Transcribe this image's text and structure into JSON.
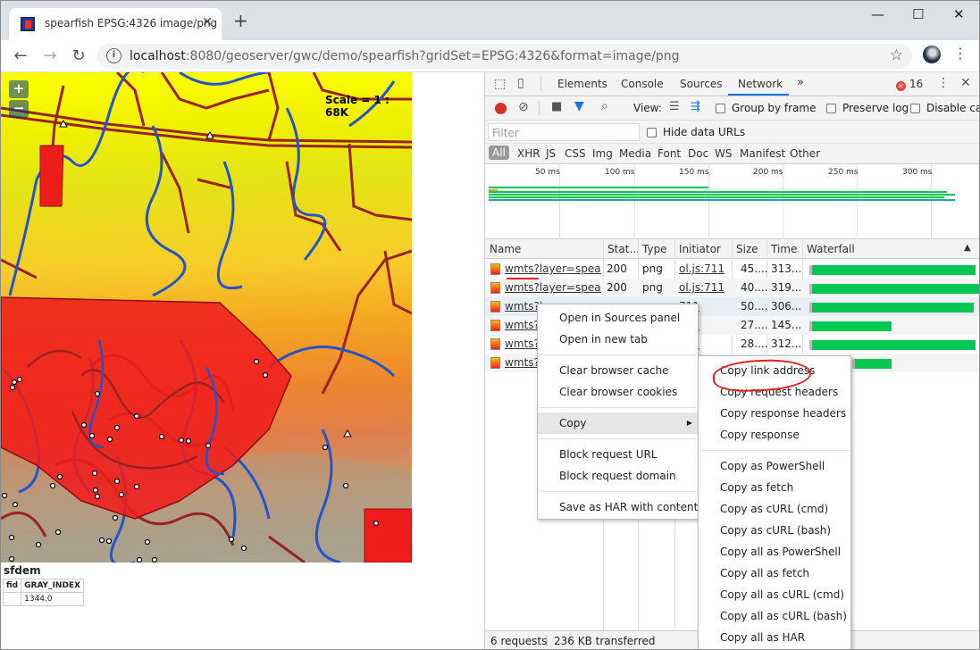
{
  "browser": {
    "tab_title": "spearfish EPSG:4326 image/png",
    "tab_close": "✕",
    "new_tab": "+",
    "win_min": "—",
    "win_max": "☐",
    "win_close": "✕",
    "url_host": "localhost",
    "url_rest": ":8080/geoserver/gwc/demo/spearfish?gridSet=EPSG:4326&format=image/png"
  },
  "map": {
    "zoom_in": "+",
    "zoom_out": "−",
    "scale_text": "Scale = 1 : 68K",
    "info_layer": "sfdem",
    "info_headers": [
      "fid",
      "GRAY_INDEX"
    ],
    "info_values": [
      "",
      "1344.0"
    ]
  },
  "devtools": {
    "tabs": [
      "Elements",
      "Console",
      "Sources",
      "Network"
    ],
    "more": "»",
    "error_count": "16",
    "view_label": "View:",
    "group_by_frame": "Group by frame",
    "preserve_log": "Preserve log",
    "disable_cache": "Disable cac",
    "filter_placeholder": "Filter",
    "hide_data_urls": "Hide data URLs",
    "types": [
      "All",
      "XHR",
      "JS",
      "CSS",
      "Img",
      "Media",
      "Font",
      "Doc",
      "WS",
      "Manifest",
      "Other"
    ],
    "ticks": [
      "50 ms",
      "100 ms",
      "150 ms",
      "200 ms",
      "250 ms",
      "300 ms"
    ],
    "columns": [
      "Name",
      "Stat...",
      "Type",
      "Initiator",
      "Size",
      "Time",
      "Waterfall"
    ],
    "rows": [
      {
        "name": "wmts?layer=spea...",
        "status": "200",
        "type": "png",
        "initiator": "ol.js:711",
        "size": "45....",
        "time": "313...",
        "bar_start": 0.03,
        "bar_end": 0.98
      },
      {
        "name": "wmts?layer=spea...",
        "status": "200",
        "type": "png",
        "initiator": "ol.js:711",
        "size": "40....",
        "time": "319...",
        "bar_start": 0.03,
        "bar_end": 1.0
      },
      {
        "name": "wmts?l",
        "status": "",
        "type": "",
        "initiator": "711",
        "size": "50....",
        "time": "306...",
        "bar_start": 0.03,
        "bar_end": 0.97
      },
      {
        "name": "wmts?l",
        "status": "",
        "type": "",
        "initiator": "711",
        "size": "27....",
        "time": "145...",
        "bar_start": 0.03,
        "bar_end": 0.49
      },
      {
        "name": "wmts?l",
        "status": "",
        "type": "",
        "initiator": "711",
        "size": "28....",
        "time": "312...",
        "bar_start": 0.03,
        "bar_end": 0.98
      },
      {
        "name": "wmts?l",
        "status": "",
        "type": "",
        "initiator": "",
        "size": "",
        "time": "",
        "bar_start": 0.28,
        "bar_end": 0.49
      }
    ],
    "footer_requests": "6 requests",
    "footer_sep": "|",
    "footer_transferred": "236 KB transferred"
  },
  "context_menu": {
    "items": [
      "Open in Sources panel",
      "Open in new tab",
      "Clear browser cache",
      "Clear browser cookies",
      "Copy",
      "Block request URL",
      "Block request domain",
      "Save as HAR with content"
    ],
    "submenu_arrow": "▶"
  },
  "copy_submenu": {
    "items": [
      "Copy link address",
      "Copy request headers",
      "Copy response headers",
      "Copy response",
      "Copy as PowerShell",
      "Copy as fetch",
      "Copy as cURL (cmd)",
      "Copy as cURL (bash)",
      "Copy all as PowerShell",
      "Copy all as fetch",
      "Copy all as cURL (cmd)",
      "Copy all as cURL (bash)",
      "Copy all as HAR"
    ]
  }
}
